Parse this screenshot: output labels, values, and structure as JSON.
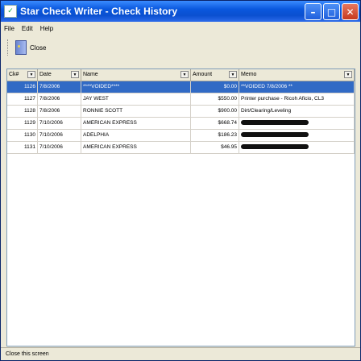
{
  "window": {
    "title": "Star Check Writer - Check History"
  },
  "menu": [
    {
      "label": "File"
    },
    {
      "label": "Edit"
    },
    {
      "label": "Help"
    }
  ],
  "toolbar": {
    "close_label": "Close"
  },
  "grid": {
    "columns": [
      {
        "label": "Ck#"
      },
      {
        "label": "Date"
      },
      {
        "label": "Name"
      },
      {
        "label": "Amount"
      },
      {
        "label": "Memo"
      }
    ],
    "rows": [
      {
        "ck": "1126",
        "date": "7/8/2006",
        "name": "****VOIDED****",
        "amount": "$0.00",
        "memo": "**VOIDED 7/8/2006 **",
        "selected": true
      },
      {
        "ck": "1127",
        "date": "7/8/2006",
        "name": "JAY WEST",
        "amount": "$550.00",
        "memo": "Printer purchase - Ricoh Aficio, CL3"
      },
      {
        "ck": "1128",
        "date": "7/8/2006",
        "name": "RONNIE SCOTT",
        "amount": "$900.00",
        "memo": "Dirt/Clearing/Leveling"
      },
      {
        "ck": "1129",
        "date": "7/10/2006",
        "name": "AMERICAN EXPRESS",
        "amount": "$668.74",
        "memo": ""
      },
      {
        "ck": "1130",
        "date": "7/10/2006",
        "name": "ADELPHIA",
        "amount": "$186.23",
        "memo": ""
      },
      {
        "ck": "1131",
        "date": "7/10/2006",
        "name": "AMERICAN EXPRESS",
        "amount": "$46.95",
        "memo": ""
      }
    ]
  },
  "status": {
    "text": "Close this screen"
  }
}
